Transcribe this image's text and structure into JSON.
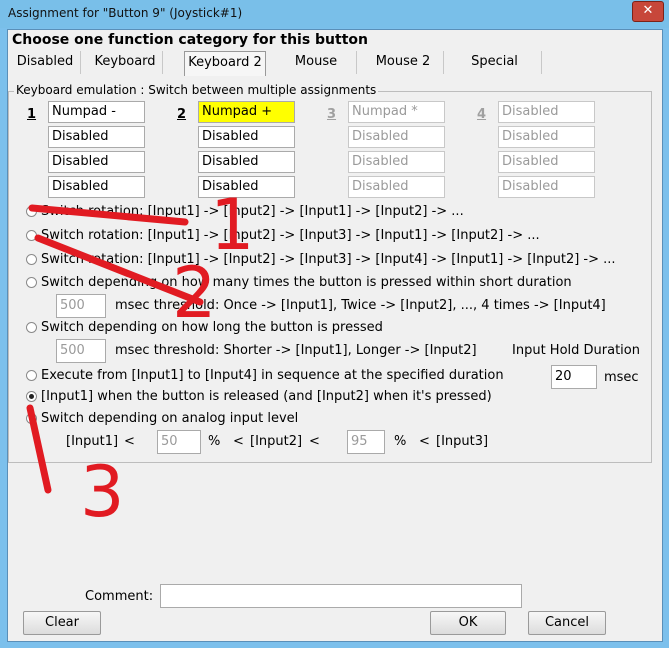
{
  "window": {
    "title": "Assignment for \"Button 9\" (Joystick#1)",
    "close_glyph": "✕"
  },
  "heading": "Choose one function category for this button",
  "tabs": [
    "Disabled",
    "Keyboard",
    "Keyboard 2",
    "Mouse",
    "Mouse 2",
    "Special"
  ],
  "active_tab": "Keyboard 2",
  "group_label": "Keyboard emulation : Switch between multiple assignments",
  "columns": [
    {
      "num": "1",
      "inputs": [
        "Numpad -",
        "Disabled",
        "Disabled",
        "Disabled"
      ]
    },
    {
      "num": "2",
      "inputs": [
        "Numpad +",
        "Disabled",
        "Disabled",
        "Disabled"
      ]
    },
    {
      "num": "3",
      "inputs": [
        "Numpad *",
        "Disabled",
        "Disabled",
        "Disabled"
      ]
    },
    {
      "num": "4",
      "inputs": [
        "Disabled",
        "Disabled",
        "Disabled",
        "Disabled"
      ]
    }
  ],
  "options": [
    "Switch rotation: [Input1] -> [Input2] -> [Input1] -> [Input2] -> ...",
    "Switch rotation: [Input1] -> [Input2] -> [Input3] -> [Input1] -> [Input2] -> ...",
    "Switch rotation: [Input1] -> [Input2] -> [Input3] -> [Input4] -> [Input1] -> [Input2] -> ...",
    "Switch depending on how many times the button is pressed within short duration",
    "Switch depending on how long the button is pressed",
    "Execute from [Input1] to [Input4] in sequence at the specified duration",
    "[Input1] when the button is released (and [Input2] when it's pressed)",
    "Switch depending on analog input level"
  ],
  "selected_option": 6,
  "press_count": {
    "value": "500",
    "text": "msec threshold: Once -> [Input1], Twice -> [Input2], ..., 4 times -> [Input4]"
  },
  "press_long": {
    "value": "500",
    "text": "msec threshold: Shorter -> [Input1], Longer -> [Input2]"
  },
  "hold": {
    "label": "Input Hold Duration",
    "value": "20",
    "unit": "msec"
  },
  "analog": {
    "in1": "[Input1]",
    "lt": "<",
    "v1": "50",
    "pct": "%",
    "in2": "[Input2]",
    "v2": "95",
    "in3": "[Input3]"
  },
  "comment": {
    "label": "Comment:",
    "value": ""
  },
  "buttons": {
    "clear": "Clear",
    "ok": "OK",
    "cancel": "Cancel"
  },
  "annotations": [
    "1",
    "2",
    "3"
  ],
  "colors": {
    "annotation": "#e11b22",
    "highlight": "#ffff00",
    "close": "#c7473a"
  }
}
